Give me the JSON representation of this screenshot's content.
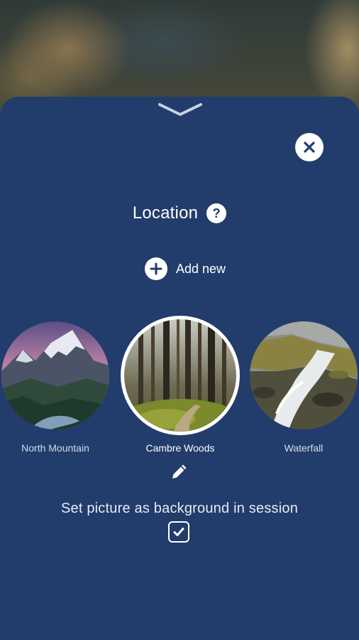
{
  "sheet": {
    "title": "Location",
    "add_new_label": "Add new",
    "background_option_label": "Set picture as background in session",
    "background_option_checked": true
  },
  "locations": [
    {
      "name": "North Mountain",
      "selected": false,
      "icon": "mountain-photo"
    },
    {
      "name": "Cambre Woods",
      "selected": true,
      "icon": "forest-photo"
    },
    {
      "name": "Waterfall",
      "selected": false,
      "icon": "waterfall-photo"
    }
  ],
  "colors": {
    "sheet_background": "#223c6c",
    "accent": "#ffffff"
  }
}
